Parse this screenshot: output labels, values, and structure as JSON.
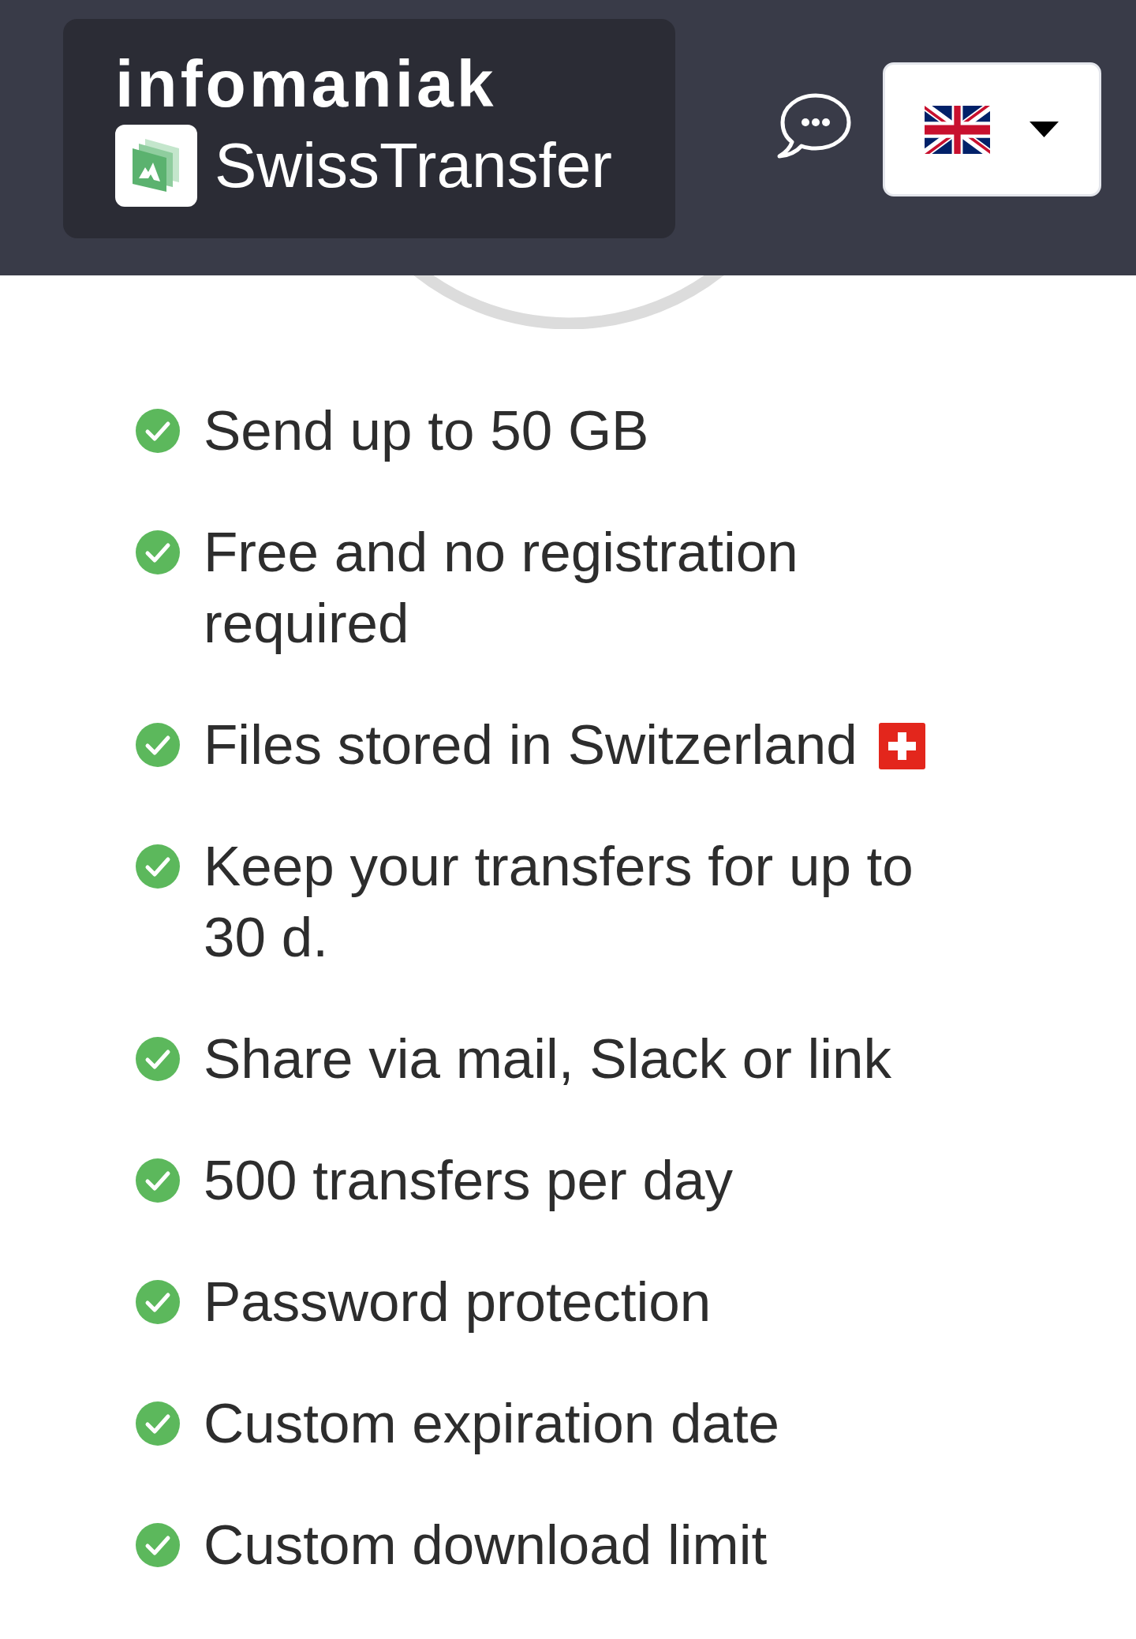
{
  "header": {
    "brand": "infomaniak",
    "product": "SwissTransfer"
  },
  "features": [
    {
      "text": "Send up to 50 GB",
      "kind": "text"
    },
    {
      "text": "Free and no registration required",
      "kind": "text"
    },
    {
      "text": "Files stored in Switzerland",
      "kind": "flag"
    },
    {
      "text": "Keep your transfers for up to 30 d.",
      "kind": "text"
    },
    {
      "text": "Share via mail, Slack or link",
      "kind": "text"
    },
    {
      "text": "500 transfers per day",
      "kind": "text"
    },
    {
      "text": "Password protection",
      "kind": "text"
    },
    {
      "text": "Custom expiration date",
      "kind": "text"
    },
    {
      "text": "Custom download limit",
      "kind": "text"
    }
  ]
}
